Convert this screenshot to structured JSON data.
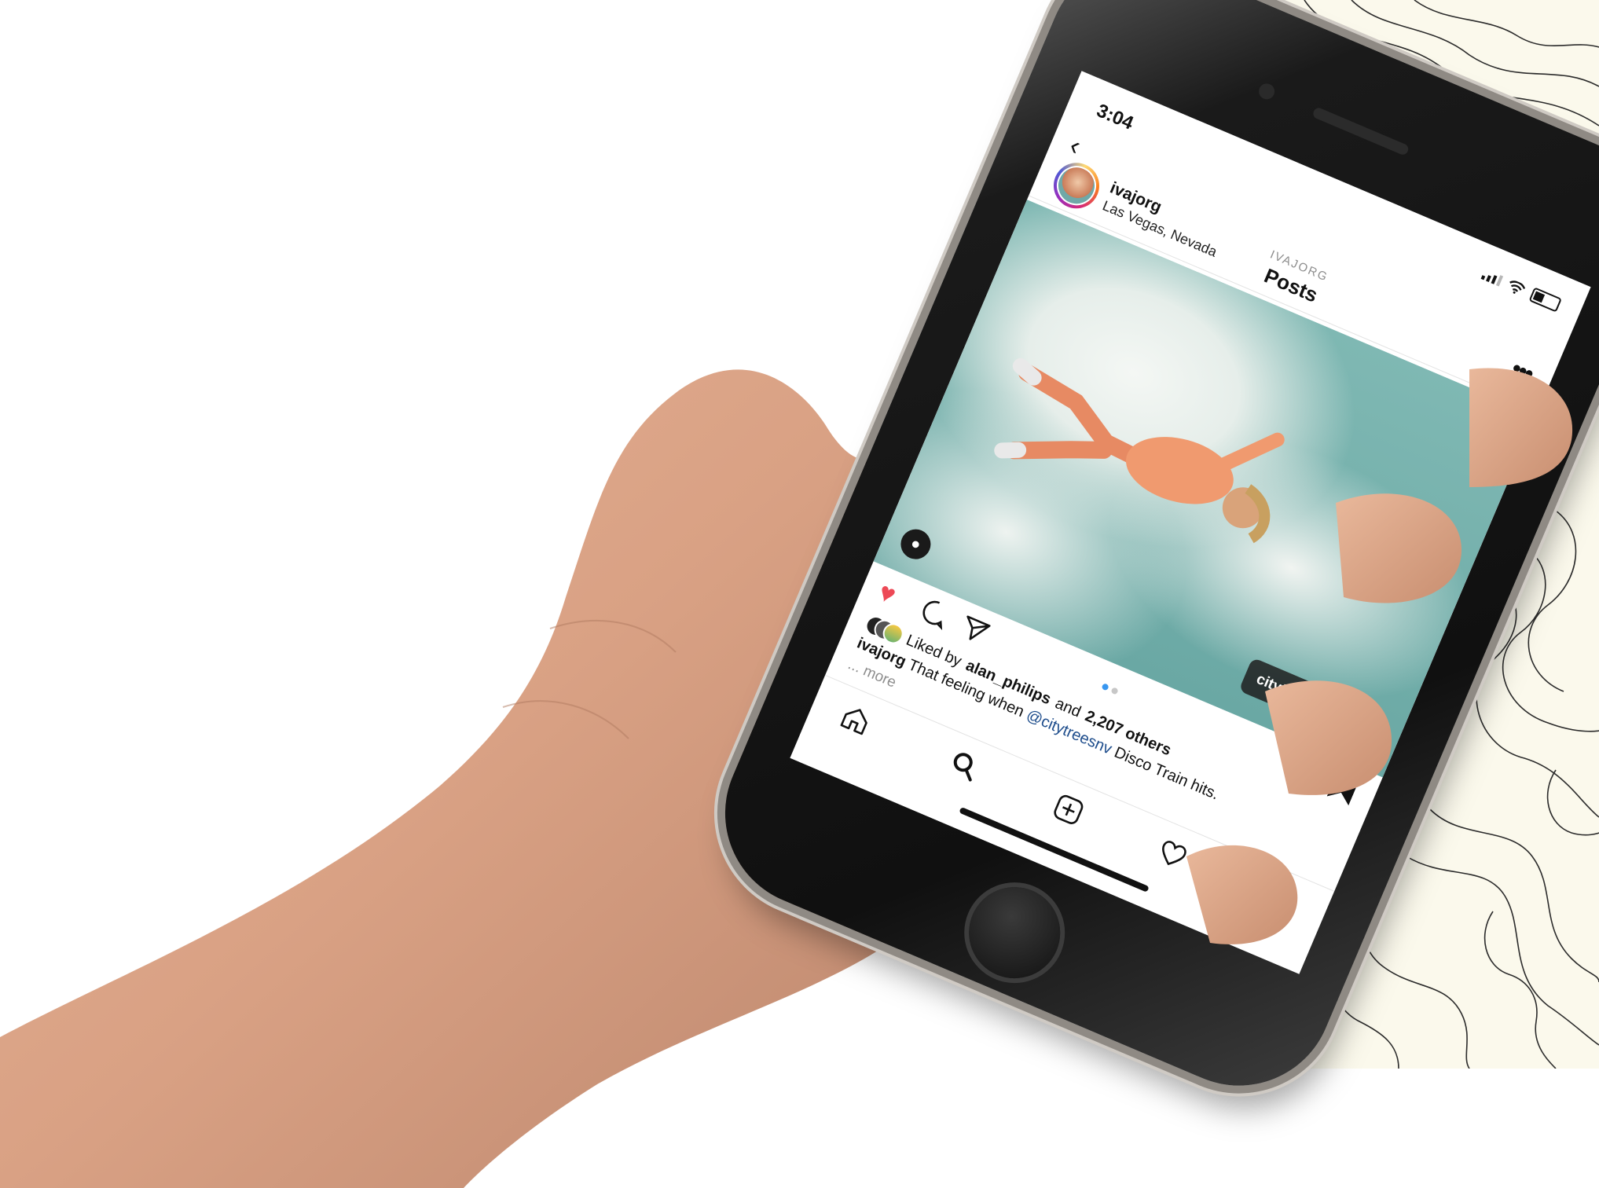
{
  "status_bar": {
    "time": "3:04"
  },
  "nav": {
    "back_icon": "chevron-left-icon",
    "subtitle": "IVAJORG",
    "title": "Posts"
  },
  "post": {
    "username": "ivajorg",
    "location": "Las Vegas, Nevada",
    "options_icon": "more-horizontal-icon",
    "photo_tag": "citytreesnv",
    "carousel_dots": {
      "total": 2,
      "active": 1
    },
    "liked_by_prefix": "Liked by",
    "liked_by_user": "alan_philips",
    "liked_by_and": "and",
    "liked_by_count": "2,207 others",
    "caption_user": "ivajorg",
    "caption_text_1": "That feeling when",
    "caption_mention": "@citytreesnv",
    "caption_text_2": "Disco Train hits.",
    "more_label": "... more"
  },
  "tab_bar": {
    "items": [
      "home-icon",
      "search-icon",
      "add-post-icon",
      "activity-heart-icon",
      "profile-avatar"
    ]
  },
  "colors": {
    "like_red": "#ed4956",
    "link_blue": "#1e4d8c",
    "dot_active": "#3897f0",
    "sky": "#7fb8b3"
  }
}
